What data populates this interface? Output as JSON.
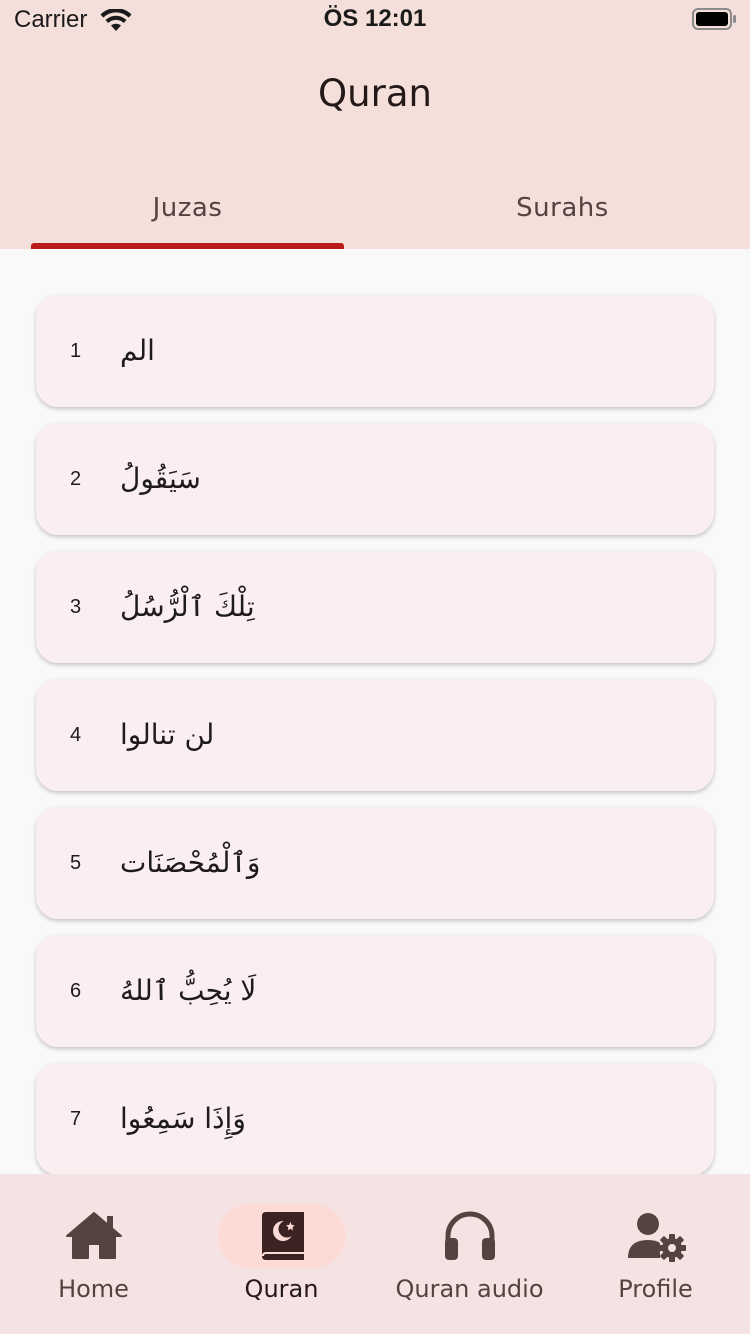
{
  "status_bar": {
    "carrier": "Carrier",
    "time": "ÖS 12:01"
  },
  "app_bar": {
    "title": "Quran"
  },
  "tabs": [
    {
      "label": "Juzas",
      "active": true
    },
    {
      "label": "Surahs",
      "active": false
    }
  ],
  "juz_list": [
    {
      "number": "1",
      "name": "الم"
    },
    {
      "number": "2",
      "name": "سَيَقُولُ"
    },
    {
      "number": "3",
      "name": "تِلْكَ ٱلْرُّسُلُ"
    },
    {
      "number": "4",
      "name": "لن تنالوا"
    },
    {
      "number": "5",
      "name": "وَٱلْمُحْصَنَات"
    },
    {
      "number": "6",
      "name": "لَا يُحِبُّ ٱللهُ"
    },
    {
      "number": "7",
      "name": "وَإِذَا سَمِعُوا"
    }
  ],
  "bottom_nav": [
    {
      "label": "Home",
      "icon": "home-icon",
      "active": false
    },
    {
      "label": "Quran",
      "icon": "quran-book-icon",
      "active": true
    },
    {
      "label": "Quran audio",
      "icon": "headphones-icon",
      "active": false
    },
    {
      "label": "Profile",
      "icon": "user-gear-icon",
      "active": false
    }
  ],
  "colors": {
    "header_bg": "#f5dfda",
    "accent": "#bb1a1a",
    "card_bg": "#faeef0",
    "nav_bg": "#f5e2e2",
    "nav_active_pill": "#fcdad6"
  }
}
